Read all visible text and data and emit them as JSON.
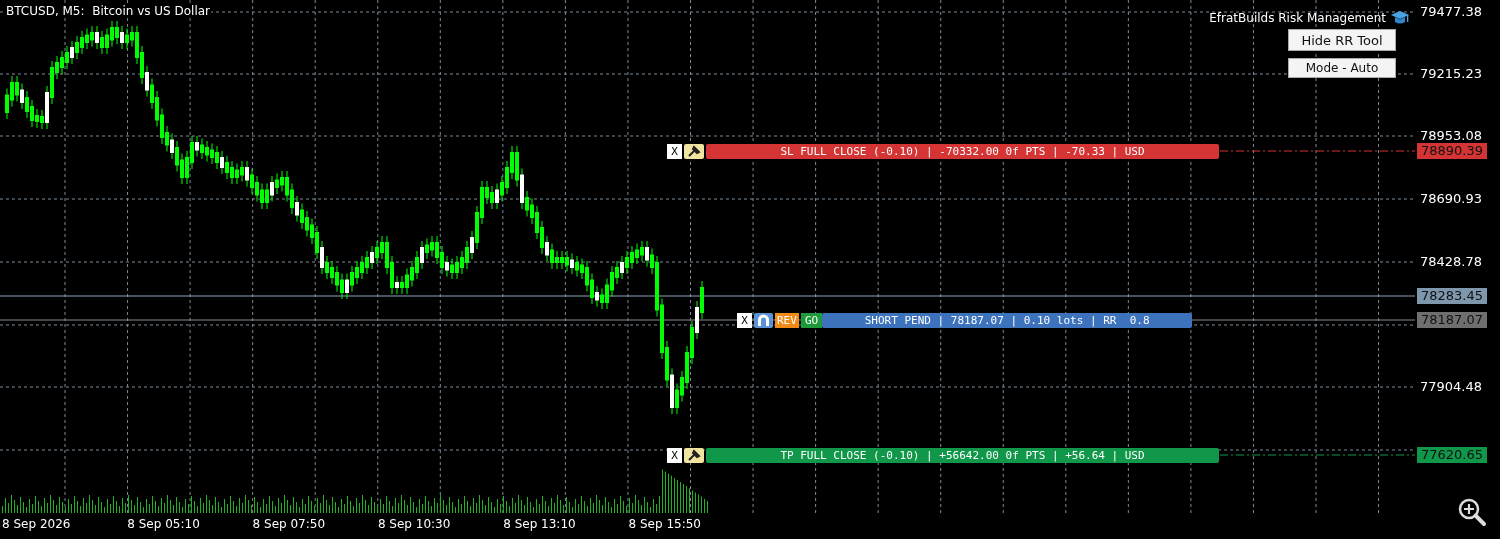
{
  "chart": {
    "title": "BTCUSD, M5:  Bitcoin vs US Dollar",
    "price_axis": [
      "79477.38",
      "79215.23",
      "78953.08",
      "78690.93",
      "78428.78",
      "77904.48"
    ],
    "time_axis": [
      "8 Sep 2026",
      "8 Sep 05:10",
      "8 Sep 07:50",
      "8 Sep 10:30",
      "8 Sep 13:10",
      "8 Sep 15:50"
    ],
    "price_tags": [
      {
        "kind": "sl",
        "text": "78890.39"
      },
      {
        "kind": "bid",
        "text": "78283.45"
      },
      {
        "kind": "entry",
        "text": "78187.07"
      },
      {
        "kind": "tp",
        "text": "77620.65"
      }
    ]
  },
  "panel": {
    "title": "EfratBuilds Risk Management",
    "buttons": [
      "Hide RR Tool",
      "Mode - Auto"
    ]
  },
  "levels": [
    {
      "kind": "sl",
      "close_button": "X",
      "label": "SL FULL CLOSE (-0.10) | -70332.00 0f PTS | -70.33 | USD"
    },
    {
      "kind": "entry",
      "close_button": "X",
      "reverse_button": "REV",
      "go_button": "GO",
      "label": "SHORT PEND | 78187.07 | 0.10 lots | RR  0.8"
    },
    {
      "kind": "tp",
      "close_button": "X",
      "label": "TP FULL CLOSE (-0.10) | +56642.00 0f PTS | +56.64 | USD"
    }
  ]
}
